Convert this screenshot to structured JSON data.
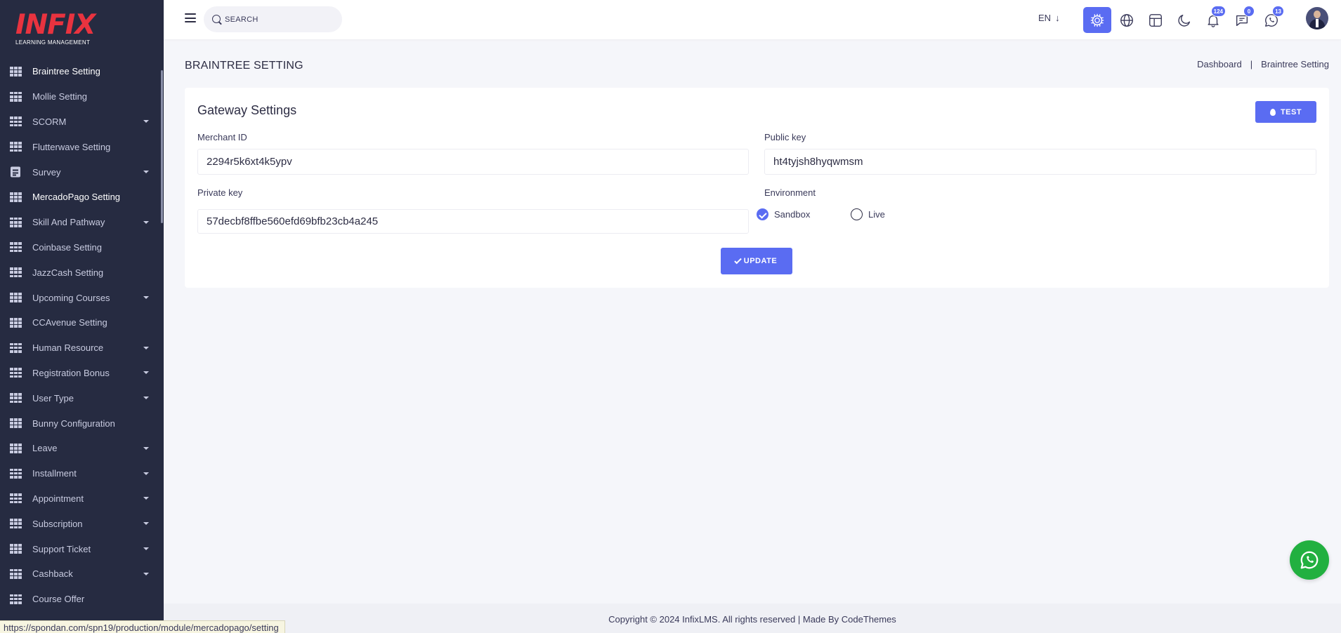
{
  "logo": {
    "mark": "INFIX",
    "subtitle": "LEARNING MANAGEMENT"
  },
  "sidebar": {
    "items": [
      {
        "label": "Braintree Setting",
        "icon": "grid-icon",
        "caret": false,
        "active": true
      },
      {
        "label": "Mollie Setting",
        "icon": "grid-icon",
        "caret": false,
        "active": false
      },
      {
        "label": "SCORM",
        "icon": "grid-icon",
        "caret": true,
        "active": false
      },
      {
        "label": "Flutterwave Setting",
        "icon": "grid-icon",
        "caret": false,
        "active": false
      },
      {
        "label": "Survey",
        "icon": "document-icon",
        "caret": true,
        "active": false
      },
      {
        "label": "MercadoPago Setting",
        "icon": "grid-icon",
        "caret": false,
        "active": true
      },
      {
        "label": "Skill And Pathway",
        "icon": "grid-icon",
        "caret": true,
        "active": false
      },
      {
        "label": "Coinbase Setting",
        "icon": "grid-icon",
        "caret": false,
        "active": false
      },
      {
        "label": "JazzCash Setting",
        "icon": "grid-icon",
        "caret": false,
        "active": false
      },
      {
        "label": "Upcoming Courses",
        "icon": "grid-icon",
        "caret": true,
        "active": false
      },
      {
        "label": "CCAvenue Setting",
        "icon": "grid-icon",
        "caret": false,
        "active": false
      },
      {
        "label": "Human Resource",
        "icon": "grid-icon",
        "caret": true,
        "active": false
      },
      {
        "label": "Registration Bonus",
        "icon": "grid-icon",
        "caret": true,
        "active": false
      },
      {
        "label": "User Type",
        "icon": "grid-icon",
        "caret": true,
        "active": false
      },
      {
        "label": "Bunny Configuration",
        "icon": "grid-icon",
        "caret": false,
        "active": false
      },
      {
        "label": "Leave",
        "icon": "grid-icon",
        "caret": true,
        "active": false
      },
      {
        "label": "Installment",
        "icon": "grid-icon",
        "caret": true,
        "active": false
      },
      {
        "label": "Appointment",
        "icon": "grid-icon",
        "caret": true,
        "active": false
      },
      {
        "label": "Subscription",
        "icon": "grid-icon",
        "caret": true,
        "active": false
      },
      {
        "label": "Support Ticket",
        "icon": "grid-icon",
        "caret": true,
        "active": false
      },
      {
        "label": "Cashback",
        "icon": "grid-icon",
        "caret": true,
        "active": false
      },
      {
        "label": "Course Offer",
        "icon": "grid-icon",
        "caret": false,
        "active": false
      }
    ]
  },
  "header": {
    "search_placeholder": "SEARCH",
    "language": "EN",
    "notifications_count": "124",
    "messages_count": "0",
    "whatsapp_count": "13"
  },
  "page": {
    "title": "BRAINTREE SETTING",
    "breadcrumb": [
      "Dashboard",
      "Braintree Setting"
    ]
  },
  "card": {
    "title": "Gateway Settings",
    "test_label": "TEST",
    "merchant_id_label": "Merchant ID",
    "merchant_id_value": "2294r5k6xt4k5ypv",
    "public_key_label": "Public key",
    "public_key_value": "ht4tyjsh8hyqwmsm",
    "private_key_label": "Private key",
    "private_key_value": "57decbf8ffbe560efd69bfb23cb4a245",
    "environment_label": "Environment",
    "environment_options": [
      "Sandbox",
      "Live"
    ],
    "environment_selected": "Sandbox",
    "update_label": "UPDATE"
  },
  "footer": {
    "text": "Copyright © 2024 InfixLMS. All rights reserved | Made By CodeThemes"
  },
  "status_url": "https://spondan.com/spn19/production/module/mercadopago/setting",
  "colors": {
    "sidebar_bg": "#262b41",
    "accent": "#5a6cf2",
    "whatsapp": "#22b040",
    "logo_red": "#e8333f"
  }
}
